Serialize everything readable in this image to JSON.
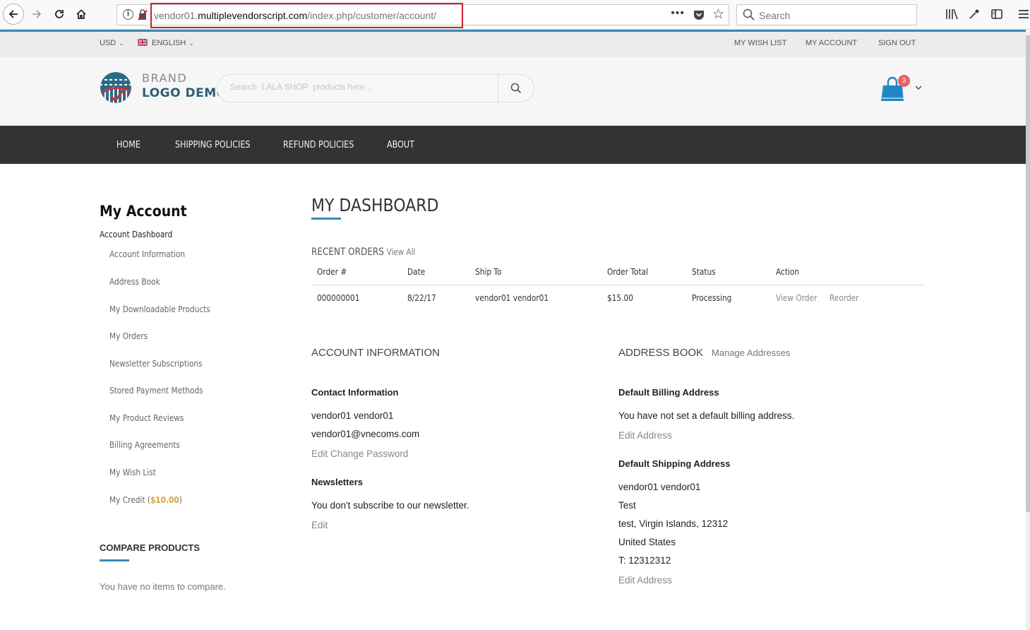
{
  "browser": {
    "url_host_prefix": "vendor01.",
    "url_host": "multiplevendorscript.com",
    "url_path": "/index.php/customer/account/",
    "page_actions": "•••",
    "search_placeholder": "Search"
  },
  "topbar": {
    "currency": "USD",
    "language": "ENGLISH",
    "links": [
      "MY WISH LIST",
      "MY ACCOUNT",
      "SIGN OUT"
    ]
  },
  "header": {
    "logo_line1": "BRAND",
    "logo_line2": "LOGO DEMO",
    "search_placeholder": "Search  LALA SHOP  products here...",
    "cart_count": "3",
    "accent_color": "#3a89b4",
    "cart_color": "#1e88c7",
    "badge_color": "#e8625f"
  },
  "nav": {
    "items": [
      "HOME",
      "SHIPPING POLICIES",
      "REFUND POLICIES",
      "ABOUT"
    ]
  },
  "sidebar": {
    "title": "My Account",
    "current": "Account Dashboard",
    "items": [
      "Account Information",
      "Address Book",
      "My Downloadable Products",
      "My Orders",
      "Newsletter Subscriptions",
      "Stored Payment Methods",
      "My Product Reviews",
      "Billing Agreements",
      "My Wish List"
    ],
    "credit_label": "My Credit (",
    "credit_value": "$10.00",
    "credit_close": ")",
    "compare_title": "COMPARE PRODUCTS",
    "compare_empty": "You have no items to compare."
  },
  "dashboard": {
    "title": "MY DASHBOARD",
    "recent_orders_label": "RECENT ORDERS",
    "view_all": "View All",
    "columns": [
      "Order #",
      "Date",
      "Ship To",
      "Order Total",
      "Status",
      "Action"
    ],
    "orders": [
      {
        "order_no": "000000001",
        "date": "8/22/17",
        "ship_to": "vendor01 vendor01",
        "total": "$15.00",
        "status": "Processing",
        "view": "View Order",
        "reorder": "Reorder"
      }
    ]
  },
  "account_info": {
    "title": "ACCOUNT INFORMATION",
    "contact_title": "Contact Information",
    "name": "vendor01 vendor01",
    "email": "vendor01@vnecoms.com",
    "edit": "Edit",
    "change_password": "Change Password",
    "newsletters_title": "Newsletters",
    "newsletters_text": "You don't subscribe to our newsletter.",
    "newsletters_edit": "Edit"
  },
  "address_book": {
    "title": "ADDRESS BOOK",
    "manage": "Manage Addresses",
    "billing_title": "Default Billing Address",
    "billing_text": "You have not set a default billing address.",
    "billing_edit": "Edit Address",
    "shipping_title": "Default Shipping Address",
    "shipping_lines": [
      "vendor01 vendor01",
      "Test",
      "test, Virgin Islands, 12312",
      "United States",
      "T: 12312312"
    ],
    "shipping_edit": "Edit Address"
  }
}
